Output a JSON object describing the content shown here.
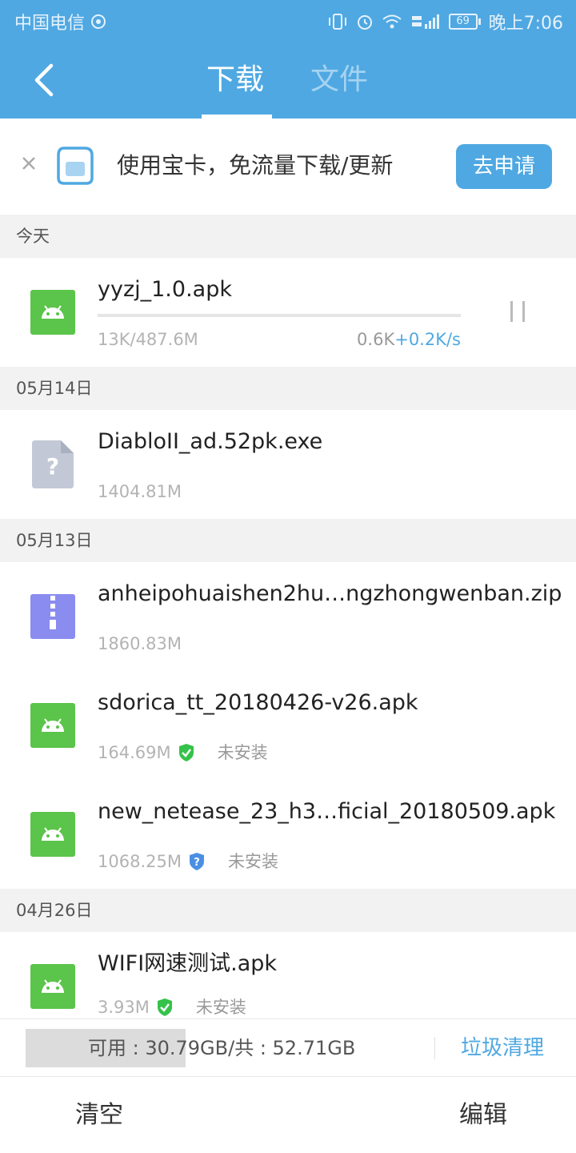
{
  "status_bar": {
    "carrier": "中国电信",
    "battery": "69",
    "time": "晚上7:06"
  },
  "header": {
    "tabs": [
      {
        "label": "下载",
        "active": true
      },
      {
        "label": "文件",
        "active": false
      }
    ]
  },
  "promo": {
    "text": "使用宝卡，免流量下载/更新",
    "button": "去申请"
  },
  "sections": [
    {
      "date": "今天",
      "items": [
        {
          "name": "yyzj_1.0.apk",
          "type": "apk",
          "progress_text": "13K/487.6M",
          "speed_base": "0.6K",
          "speed_boost": "+0.2K/s",
          "progress_fraction": 0.0
        }
      ]
    },
    {
      "date": "05月14日",
      "items": [
        {
          "name": "DiabloII_ad.52pk.exe",
          "type": "unknown",
          "size": "1404.81M"
        }
      ]
    },
    {
      "date": "05月13日",
      "items": [
        {
          "name": "anheipohuaishen2hu…ngzhongwenban.zip",
          "type": "zip",
          "size": "1860.83M"
        },
        {
          "name": "sdorica_tt_20180426-v26.apk",
          "type": "apk",
          "size": "164.69M",
          "shield": "green",
          "status": "未安装"
        },
        {
          "name": "new_netease_23_h3…ficial_20180509.apk",
          "type": "apk",
          "size": "1068.25M",
          "shield": "blue",
          "status": "未安装"
        }
      ]
    },
    {
      "date": "04月26日",
      "items": [
        {
          "name": "WIFI网速测试.apk",
          "type": "apk",
          "size": "3.93M",
          "shield": "green",
          "status": "未安装"
        }
      ]
    }
  ],
  "storage": {
    "text": "可用 : 30.79GB/共 : 52.71GB",
    "clean_label": "垃圾清理"
  },
  "bottom": {
    "clear_label": "清空",
    "edit_label": "编辑"
  },
  "colors": {
    "accent": "#4fa8e2",
    "android_green": "#5bc44a",
    "zip_purple": "#8a8cf0"
  }
}
